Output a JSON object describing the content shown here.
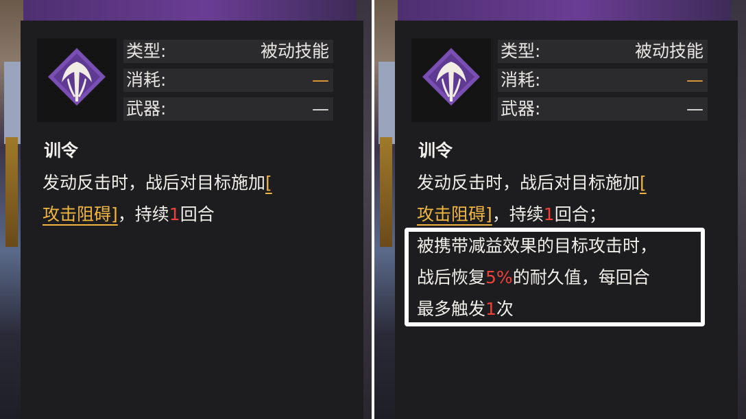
{
  "tooltips": [
    {
      "attributes": [
        {
          "key": "类型:",
          "value": "被动技能",
          "gold": false
        },
        {
          "key": "消耗:",
          "value": "—",
          "gold": true
        },
        {
          "key": "武器:",
          "value": "—",
          "gold": false
        }
      ],
      "skill_name": "训令",
      "desc_line1_a": "发动反击时，战后对目标施加",
      "desc_line1_bracket": "[",
      "desc_line2_hl": "攻击阻碍]",
      "desc_line2_b": "，持续",
      "desc_line2_num": "1",
      "desc_line2_c": "回合"
    },
    {
      "attributes": [
        {
          "key": "类型:",
          "value": "被动技能",
          "gold": false
        },
        {
          "key": "消耗:",
          "value": "—",
          "gold": true
        },
        {
          "key": "武器:",
          "value": "—",
          "gold": false
        }
      ],
      "skill_name": "训令",
      "desc_line1_a": "发动反击时，战后对目标施加",
      "desc_line1_bracket": "[",
      "desc_line2_hl": "攻击阻碍]",
      "desc_line2_b": "，持续",
      "desc_line2_num": "1",
      "desc_line2_c": "回合；",
      "extra_line1": "被携带减益效果的目标攻击时，",
      "extra_line2_a": "战后恢复",
      "extra_line2_pct": "5%",
      "extra_line2_b": "的耐久值，每回合",
      "extra_line3_a": "最多触发",
      "extra_line3_num": "1",
      "extra_line3_b": "次"
    }
  ],
  "colors": {
    "panel": "#1d1d1f",
    "attr_row": "#2b2b2d",
    "highlight_gold": "#f0b640",
    "number_red": "#f0403a",
    "icon_purple": "#7a4fb3"
  },
  "icons": [
    "skill-trident-emblem-icon"
  ]
}
